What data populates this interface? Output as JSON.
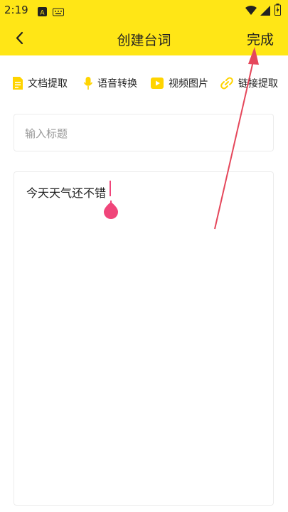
{
  "status": {
    "time": "2:19"
  },
  "header": {
    "title": "创建台词",
    "done_label": "完成"
  },
  "toolbar": {
    "items": [
      {
        "label": "文档提取",
        "icon": "document-icon"
      },
      {
        "label": "语音转换",
        "icon": "microphone-icon"
      },
      {
        "label": "视频图片",
        "icon": "video-icon"
      },
      {
        "label": "链接提取",
        "icon": "link-icon"
      }
    ]
  },
  "form": {
    "title_placeholder": "输入标题",
    "content_value": "今天天气还不错"
  },
  "colors": {
    "accent": "#FFE616",
    "cursor": "#F0457A",
    "icon": "#FFD400"
  }
}
